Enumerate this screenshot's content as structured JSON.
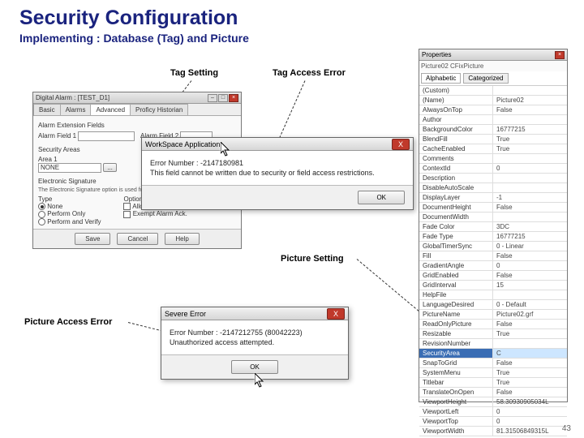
{
  "slide": {
    "title": "Security Configuration",
    "subtitle": "Implementing : Database (Tag) and Picture",
    "page_number": "43"
  },
  "labels": {
    "tag_setting": "Tag Setting",
    "tag_access_error": "Tag Access Error",
    "picture_setting": "Picture Setting",
    "picture_access_error": "Picture Access Error"
  },
  "tag_dialog": {
    "title": "Digital Alarm : [TEST_D1]",
    "tabs": [
      "Basic",
      "Alarms",
      "Advanced",
      "Proficy Historian"
    ],
    "active_tab": "Advanced",
    "section_alarm_ext": "Alarm Extension Fields",
    "alarm_field1": "Alarm Field 1",
    "alarm_field2": "Alarm Field 2",
    "section_security": "Security Areas",
    "area1_label": "Area 1",
    "area1_value": "NONE",
    "esig_header": "Electronic Signature",
    "esig_desc": "The Electronic Signature option is used for the authentication...",
    "type_group": "Type",
    "options_group": "Options",
    "opt_none": "None",
    "opt_perform": "Perform Only",
    "opt_verify": "Perform and Verify",
    "opt_allow": "Allow Continuous Use",
    "opt_exempt": "Exempt Alarm Ack.",
    "btn_save": "Save",
    "btn_cancel": "Cancel",
    "btn_help": "Help"
  },
  "tag_error": {
    "title": "WorkSpace Application",
    "error_no": "Error Number : -2147180981",
    "error_msg": "This field cannot be written due to security or field access restrictions.",
    "ok": "OK"
  },
  "pic_error": {
    "title": "Severe Error",
    "error_no": "Error Number : -2147212755 (80042223)",
    "error_msg": "Unauthorized access attempted.",
    "ok": "OK"
  },
  "props": {
    "title": "Properties",
    "object": "Picture02 CFixPicture",
    "tab_alpha": "Alphabetic",
    "tab_cat": "Categorized",
    "rows": [
      {
        "k": "(Custom)",
        "v": ""
      },
      {
        "k": "(Name)",
        "v": "Picture02"
      },
      {
        "k": "AlwaysOnTop",
        "v": "False"
      },
      {
        "k": "Author",
        "v": ""
      },
      {
        "k": "BackgroundColor",
        "v": "16777215"
      },
      {
        "k": "BlendFill",
        "v": "True"
      },
      {
        "k": "CacheEnabled",
        "v": "True"
      },
      {
        "k": "Comments",
        "v": ""
      },
      {
        "k": "ContextId",
        "v": "0"
      },
      {
        "k": "Description",
        "v": ""
      },
      {
        "k": "DisableAutoScale",
        "v": ""
      },
      {
        "k": "DisplayLayer",
        "v": "-1"
      },
      {
        "k": "DocumentHeight",
        "v": "False"
      },
      {
        "k": "DocumentWidth",
        "v": ""
      },
      {
        "k": "Fade Color",
        "v": "3DC"
      },
      {
        "k": "Fade Type",
        "v": "16777215"
      },
      {
        "k": "GlobalTimerSync",
        "v": "0 - Linear"
      },
      {
        "k": "Fill",
        "v": "False"
      },
      {
        "k": "GradientAngle",
        "v": "0"
      },
      {
        "k": "GridEnabled",
        "v": "False"
      },
      {
        "k": "GridInterval",
        "v": "15"
      },
      {
        "k": "HelpFile",
        "v": ""
      },
      {
        "k": "LanguageDesired",
        "v": "0 - Default"
      },
      {
        "k": "PictureName",
        "v": "Picture02.grf"
      },
      {
        "k": "ReadOnlyPicture",
        "v": "False"
      },
      {
        "k": "Resizable",
        "v": "True"
      },
      {
        "k": "RevisionNumber",
        "v": ""
      },
      {
        "k": "SecurityArea",
        "v": "C",
        "sel": true
      },
      {
        "k": "SnapToGrid",
        "v": "False"
      },
      {
        "k": "SystemMenu",
        "v": "True"
      },
      {
        "k": "Titlebar",
        "v": "True"
      },
      {
        "k": "TranslateOnOpen",
        "v": "False"
      },
      {
        "k": "ViewportHeight",
        "v": "58.30930905034L"
      },
      {
        "k": "ViewportLeft",
        "v": "0"
      },
      {
        "k": "ViewportTop",
        "v": "0"
      },
      {
        "k": "ViewportWidth",
        "v": "81.31506849315L"
      }
    ]
  }
}
